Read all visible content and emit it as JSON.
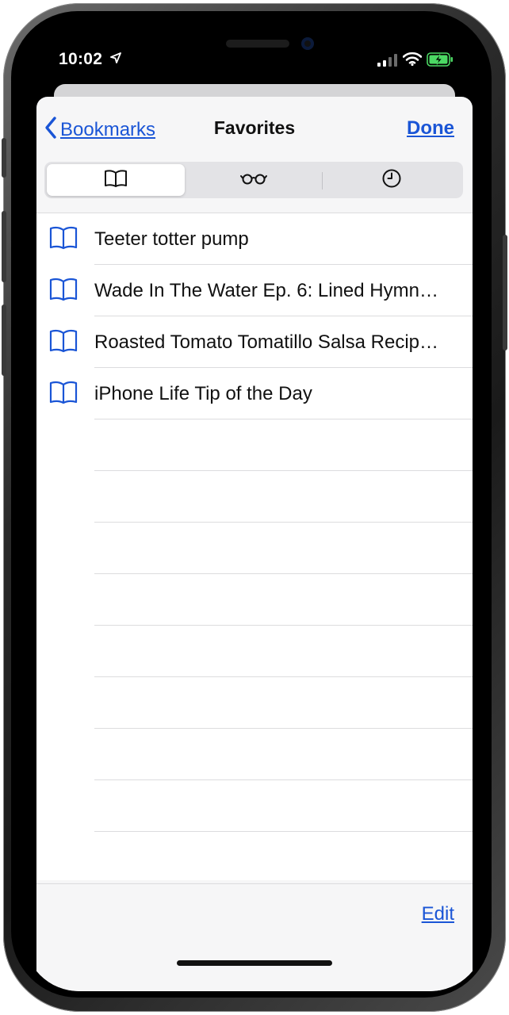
{
  "status_bar": {
    "time": "10:02",
    "location_icon": "location-arrow-icon",
    "signal_icon": "cellular-signal-icon",
    "wifi_icon": "wifi-icon",
    "battery_icon": "battery-charging-icon",
    "battery_color": "#4cd964"
  },
  "nav": {
    "back_label": "Bookmarks",
    "title": "Favorites",
    "done_label": "Done"
  },
  "segments": [
    {
      "icon": "book-icon",
      "active": true
    },
    {
      "icon": "glasses-icon",
      "active": false
    },
    {
      "icon": "clock-icon",
      "active": false
    }
  ],
  "bookmarks": [
    {
      "icon": "book-icon",
      "title": "Teeter totter pump"
    },
    {
      "icon": "book-icon",
      "title": "Wade In The Water Ep. 6: Lined Hymn…"
    },
    {
      "icon": "book-icon",
      "title": "Roasted Tomato Tomatillo Salsa Recip…"
    },
    {
      "icon": "book-icon",
      "title": "iPhone Life Tip of the Day"
    }
  ],
  "toolbar": {
    "edit_label": "Edit"
  },
  "colors": {
    "accent": "#1a55d6",
    "text": "#111111",
    "separator": "#dcdcde",
    "sheet_background": "#f6f6f7"
  }
}
